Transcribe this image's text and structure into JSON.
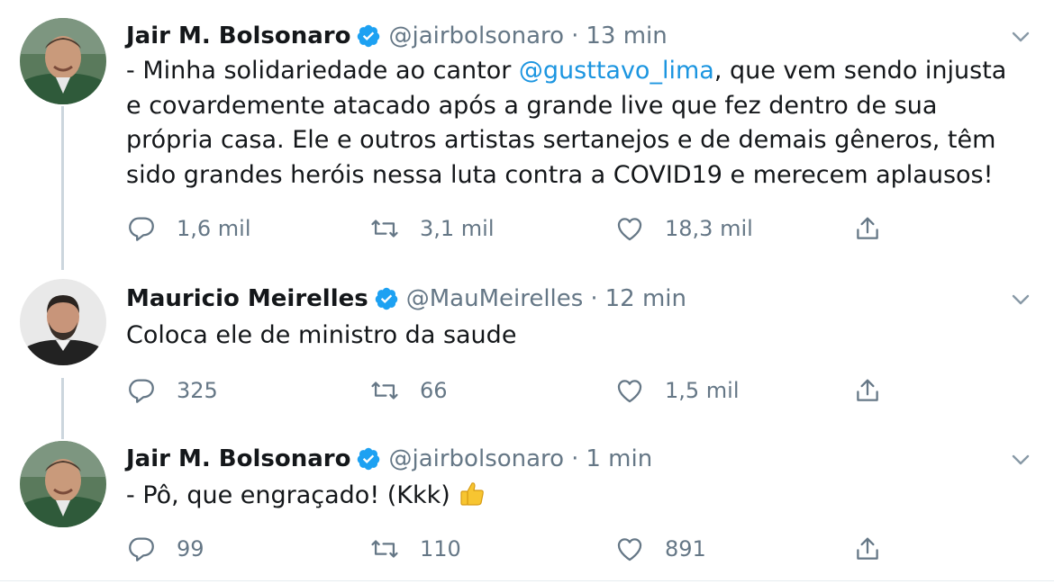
{
  "tweets": [
    {
      "name": "Jair M. Bolsonaro",
      "handle": "@jairbolsonaro",
      "separator": "·",
      "time": "13 min",
      "text_before": "- Minha solidariedade ao cantor ",
      "mention": "@gusttavo_lima",
      "text_after": ", que vem sendo injusta e covardemente atacado após a grande live que fez dentro de sua própria casa. Ele e outros artistas sertanejos e de demais gêneros, têm sido grandes heróis nessa luta contra a COVID19 e merecem aplausos!",
      "replies": "1,6 mil",
      "retweets": "3,1 mil",
      "likes": "18,3 mil",
      "verified": true
    },
    {
      "name": "Mauricio Meirelles",
      "handle": "@MauMeirelles",
      "separator": "·",
      "time": "12 min",
      "text": "Coloca ele de ministro da saude",
      "replies": "325",
      "retweets": "66",
      "likes": "1,5 mil",
      "verified": true
    },
    {
      "name": "Jair M. Bolsonaro",
      "handle": "@jairbolsonaro",
      "separator": "·",
      "time": "1 min",
      "text": "- Pô, que engraçado! (Kkk)",
      "emoji": "thumbs-up-emoji",
      "replies": "99",
      "retweets": "110",
      "likes": "891",
      "verified": true
    }
  ],
  "icons": {
    "reply": "reply-icon",
    "retweet": "retweet-icon",
    "like": "heart-icon",
    "share": "share-icon",
    "verified": "verified-badge-icon",
    "caret": "chevron-down-icon"
  },
  "colors": {
    "verified": "#1da1f2",
    "mention": "#1b95e0",
    "secondary_text": "#657786",
    "thread_line": "#ccd6dd"
  }
}
